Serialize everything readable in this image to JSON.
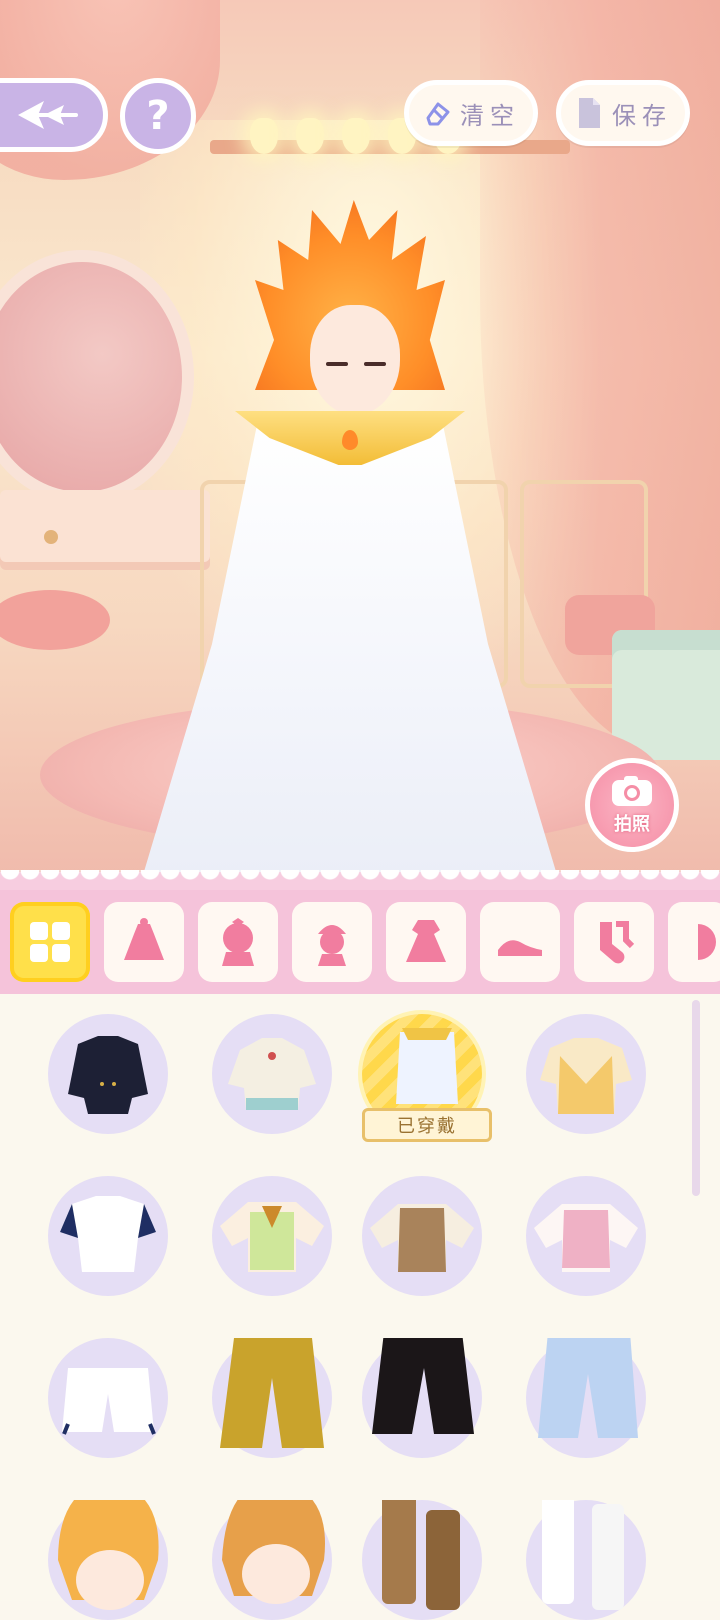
{
  "toolbar": {
    "clear_label": "清空",
    "save_label": "保存",
    "photo_label": "拍照",
    "help_glyph": "?"
  },
  "icons": {
    "back": "back-arrow-icon",
    "help": "question-icon",
    "clear": "eraser-icon",
    "save": "document-icon",
    "photo": "camera-icon"
  },
  "categories": [
    {
      "name": "all",
      "icon": "grid-icon",
      "active": true
    },
    {
      "name": "outfit-set",
      "icon": "dress-set-icon",
      "active": false
    },
    {
      "name": "hair",
      "icon": "head-icon",
      "active": false
    },
    {
      "name": "accessory",
      "icon": "hat-bust-icon",
      "active": false
    },
    {
      "name": "dress",
      "icon": "dress-icon",
      "active": false
    },
    {
      "name": "shoes",
      "icon": "shoes-icon",
      "active": false
    },
    {
      "name": "socks",
      "icon": "socks-icon",
      "active": false
    },
    {
      "name": "more",
      "icon": "partial-icon",
      "active": false
    }
  ],
  "items": {
    "worn_label": "已穿戴",
    "rows": [
      [
        "black-jacket",
        "cream-blouse",
        "white-sleeveless-top",
        "yellow-argyle-vest"
      ],
      [
        "white-navy-tshirt",
        "green-plaid-shirt",
        "brown-vest-shirt",
        "pink-vest-shirt"
      ],
      [
        "white-shorts",
        "mustard-shorts",
        "black-shorts",
        "blue-shorts"
      ],
      [
        "orange-hair",
        "blonde-hair",
        "brown-boots",
        "white-socks"
      ]
    ],
    "worn_item": "white-sleeveless-top"
  },
  "colors": {
    "accent_yellow": "#ffd84b",
    "category_pink": "#f5c3da",
    "button_lavender": "#c9b4e6",
    "photo_pink": "#f58ea6"
  }
}
